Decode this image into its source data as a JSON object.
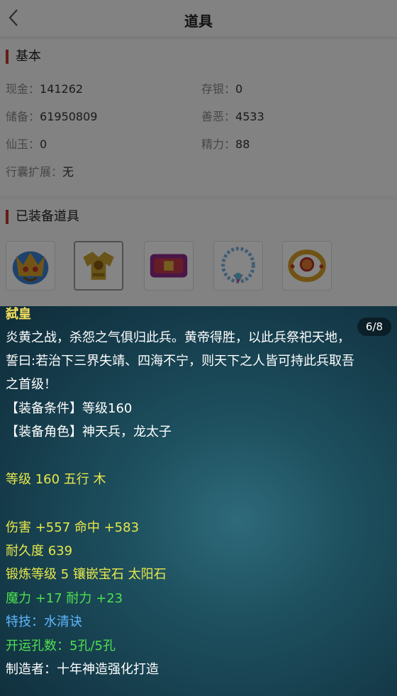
{
  "header": {
    "title": "道具"
  },
  "basic": {
    "title": "基本",
    "fields": [
      {
        "label": "现金",
        "value": "141262"
      },
      {
        "label": "存银",
        "value": "0"
      },
      {
        "label": "储备",
        "value": "61950809"
      },
      {
        "label": "善恶",
        "value": "4533"
      },
      {
        "label": "仙玉",
        "value": "0"
      },
      {
        "label": "精力",
        "value": "88"
      },
      {
        "label": "行囊扩展",
        "value": "无"
      }
    ],
    "separator": "："
  },
  "equipped": {
    "title": "已装备道具",
    "items": [
      "helmet-icon",
      "armor-icon",
      "belt-icon",
      "necklace-icon",
      "bracelet-icon"
    ],
    "selected_index": 1
  },
  "tooltip": {
    "pager": "6/8",
    "name": "弑皇",
    "desc1": "炎黄之战，杀怨之气俱归此兵。黄帝得胜，以此兵祭祀天地，",
    "desc2": "誓曰:若治下三界失靖、四海不宁，则天下之人皆可持此兵取吾",
    "desc3": "之首级！",
    "cond": "【装备条件】等级160",
    "role": "【装备角色】神天兵，龙太子",
    "level": "等级 160 五行 木",
    "attack": "伤害 +557 命中 +583",
    "durability": "耐久度 639",
    "forge": "锻炼等级 5 镶嵌宝石 太阳石",
    "magic": "魔力 +17 耐力 +23",
    "skill": "特技：水清诀",
    "holes": "开运孔数：5孔/5孔",
    "maker": "制造者：十年神造强化打造",
    "colors": {
      "name": "#f6e05a",
      "desc": "#ffffff",
      "yellow": "#e8e84a",
      "green": "#4fe04f",
      "blue": "#5fb8ff"
    }
  }
}
